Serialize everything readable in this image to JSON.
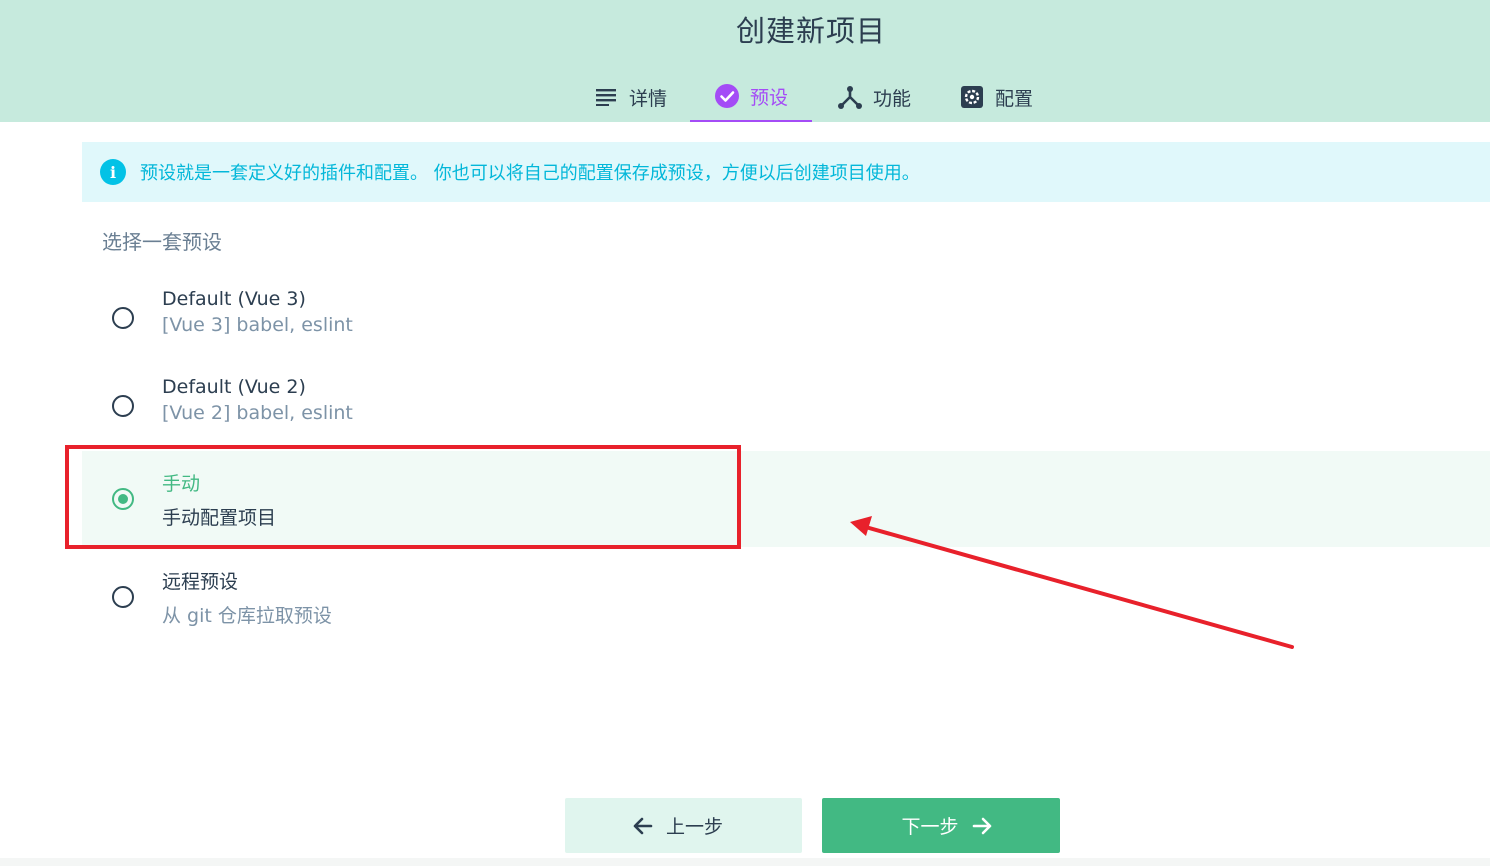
{
  "header": {
    "title": "创建新项目",
    "tabs": [
      {
        "label": "详情",
        "icon": "list-icon",
        "active": false
      },
      {
        "label": "预设",
        "icon": "check-circle-icon",
        "active": true
      },
      {
        "label": "功能",
        "icon": "fork-icon",
        "active": false
      },
      {
        "label": "配置",
        "icon": "gear-box-icon",
        "active": false
      }
    ]
  },
  "info": {
    "icon": "info-icon",
    "text": "预设就是一套定义好的插件和配置。 你也可以将自己的配置保存成预设，方便以后创建项目使用。"
  },
  "presets": {
    "section_title": "选择一套预设",
    "options": [
      {
        "name": "Default (Vue 3)",
        "description": "[Vue 3] babel, eslint",
        "selected": false
      },
      {
        "name": "Default (Vue 2)",
        "description": "[Vue 2] babel, eslint",
        "selected": false
      },
      {
        "name": "手动",
        "description": "手动配置项目",
        "selected": true
      },
      {
        "name": "远程预设",
        "description": "从 git 仓库拉取预设",
        "selected": false
      }
    ]
  },
  "footer": {
    "prev_label": "上一步",
    "next_label": "下一步"
  },
  "colors": {
    "header_bg": "#c6eadd",
    "accent_purple": "#a44cf6",
    "accent_green": "#42b983",
    "info_blue": "#03b7d9",
    "annotation_red": "#e8212b"
  }
}
